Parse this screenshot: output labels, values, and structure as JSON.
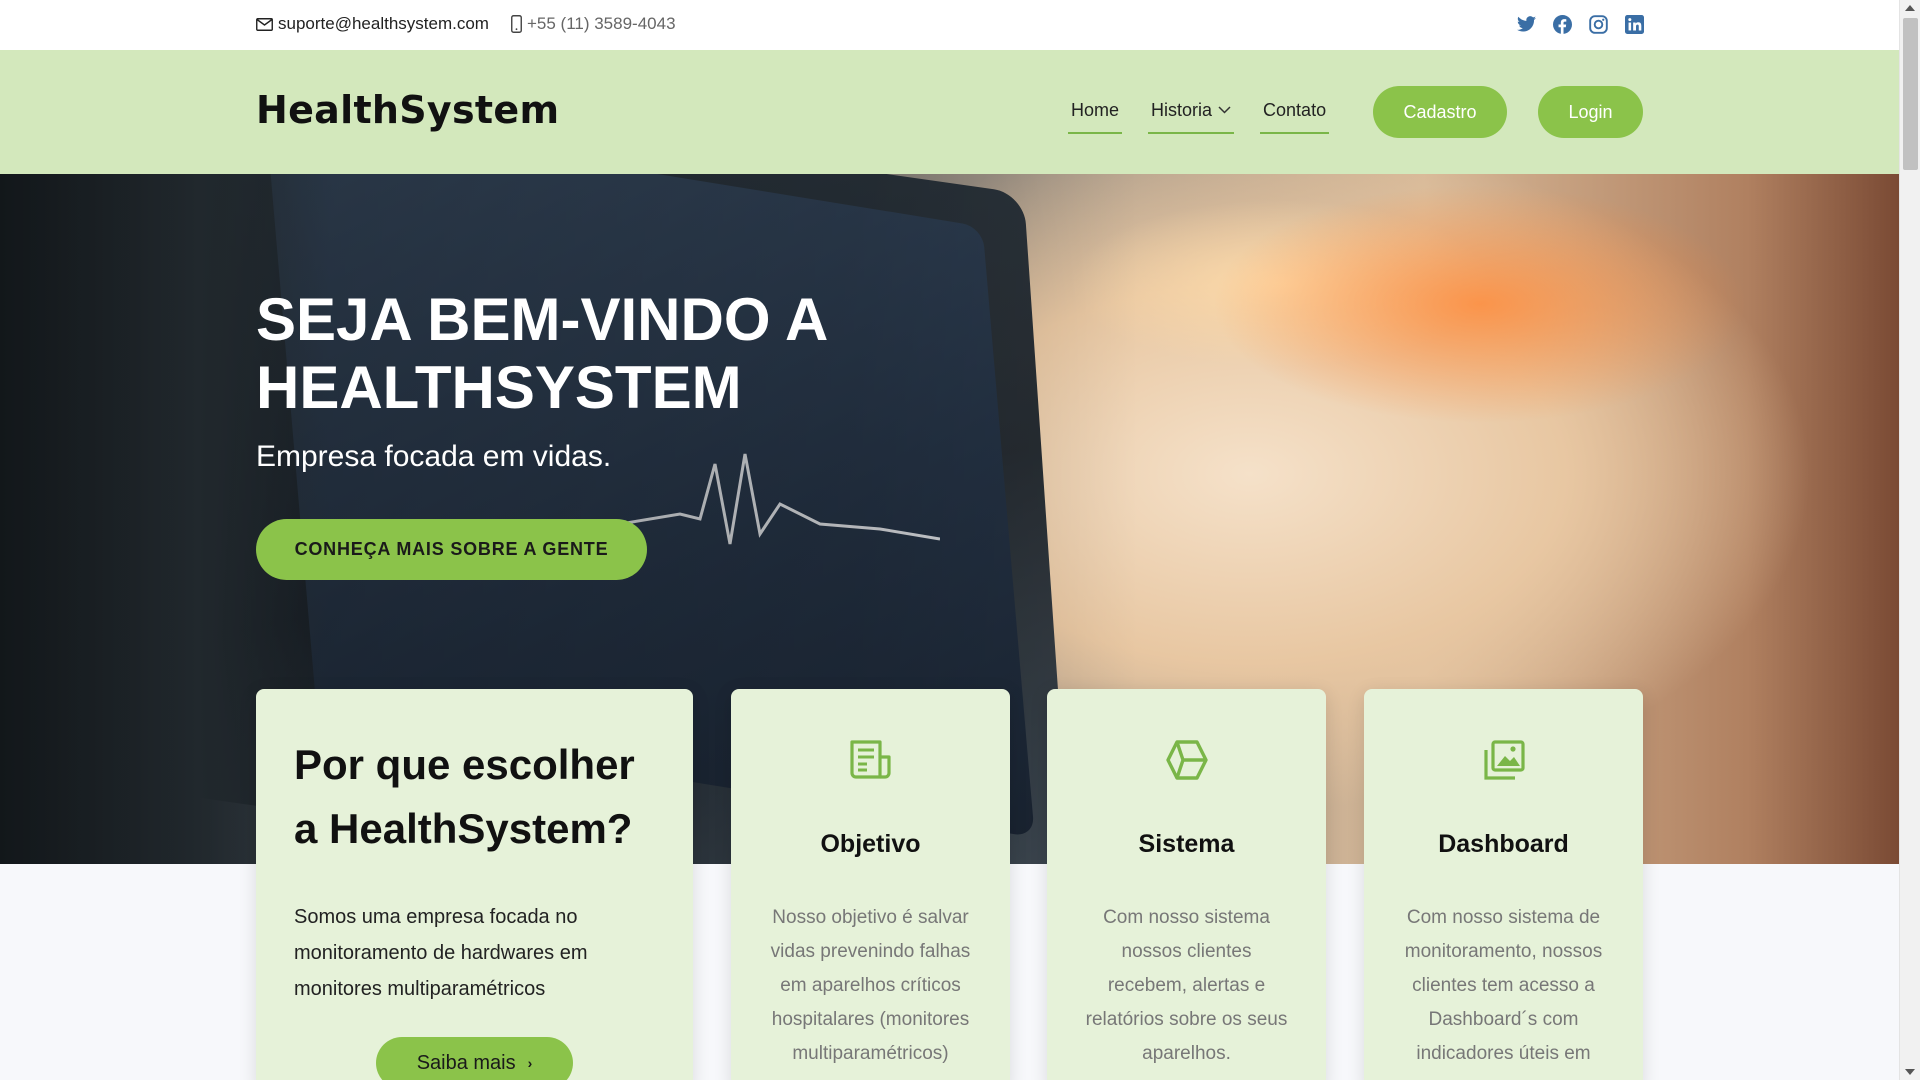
{
  "topbar": {
    "email": "suporte@healthsystem.com",
    "phone": "+55 (11) 3589-4043",
    "email_icon": "envelope-icon",
    "phone_icon": "mobile-phone-icon",
    "socials": [
      "twitter-icon",
      "facebook-icon",
      "instagram-icon",
      "linkedin-icon"
    ]
  },
  "header": {
    "logo": "HealthSystem",
    "nav": [
      {
        "label": "Home"
      },
      {
        "label": "Historia"
      },
      {
        "label": "Contato"
      }
    ],
    "signup_label": "Cadastro",
    "login_label": "Login"
  },
  "hero": {
    "title": "Seja bem-vindo a HealthSystem",
    "subtitle": "Empresa focada em vidas.",
    "cta_label": "CONHEÇA MAIS SOBRE A GENTE"
  },
  "why": {
    "title": "Por que escolher a HealthSystem?",
    "text": "Somos uma empresa focada no monitoramento de hardwares em monitores multiparamétricos",
    "button_label": "Saiba mais"
  },
  "features": [
    {
      "icon": "document-icon",
      "title": "Objetivo",
      "text": "Nosso objetivo é salvar vidas prevenindo falhas em aparelhos críticos hospitalares (monitores multiparamétricos)"
    },
    {
      "icon": "cube-icon",
      "title": "Sistema",
      "text": "Com nosso sistema nossos clientes recebem, alertas e relatórios sobre os seus aparelhos."
    },
    {
      "icon": "images-icon",
      "title": "Dashboard",
      "text": "Com nosso sistema de monitoramento, nossos clientes tem acesso a Dashboard´s com indicadores úteis em"
    }
  ],
  "colors": {
    "accent": "#8bc34a",
    "header_bg": "#d3e8bc",
    "card_bg": "#e6f2d9",
    "icon_green": "#7ab648"
  }
}
